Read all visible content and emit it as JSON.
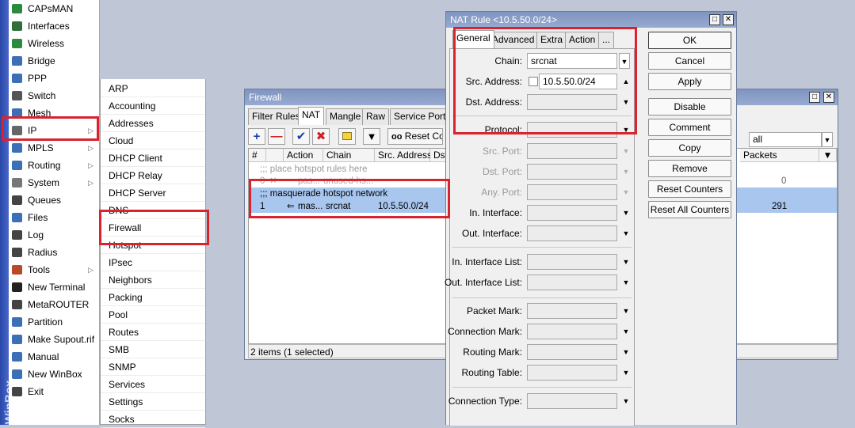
{
  "sidebar": {
    "brand": "WinBox",
    "items": [
      {
        "label": "CAPsMAN",
        "icon": "antenna-icon",
        "color": "#2b8a3e"
      },
      {
        "label": "Interfaces",
        "icon": "interfaces-icon",
        "color": "#2f6f3a"
      },
      {
        "label": "Wireless",
        "icon": "wireless-icon",
        "color": "#2b8a3e"
      },
      {
        "label": "Bridge",
        "icon": "bridge-icon",
        "color": "#3b6fb6"
      },
      {
        "label": "PPP",
        "icon": "ppp-icon",
        "color": "#3b6fb6"
      },
      {
        "label": "Switch",
        "icon": "switch-icon",
        "color": "#555555"
      },
      {
        "label": "Mesh",
        "icon": "mesh-icon",
        "color": "#3b6fb6"
      },
      {
        "label": "IP",
        "icon": "ip-icon",
        "color": "#666666",
        "arrow": true
      },
      {
        "label": "MPLS",
        "icon": "mpls-icon",
        "color": "#3b6fb6",
        "arrow": true
      },
      {
        "label": "Routing",
        "icon": "routing-icon",
        "color": "#3b6fb6",
        "arrow": true
      },
      {
        "label": "System",
        "icon": "gear-icon",
        "color": "#777777",
        "arrow": true
      },
      {
        "label": "Queues",
        "icon": "queues-icon",
        "color": "#444444"
      },
      {
        "label": "Files",
        "icon": "folder-icon",
        "color": "#3b6fb6"
      },
      {
        "label": "Log",
        "icon": "log-icon",
        "color": "#444444"
      },
      {
        "label": "Radius",
        "icon": "radius-icon",
        "color": "#444444"
      },
      {
        "label": "Tools",
        "icon": "tools-icon",
        "color": "#b84a2a",
        "arrow": true
      },
      {
        "label": "New Terminal",
        "icon": "terminal-icon",
        "color": "#222222"
      },
      {
        "label": "MetaROUTER",
        "icon": "metarouter-icon",
        "color": "#444444"
      },
      {
        "label": "Partition",
        "icon": "partition-icon",
        "color": "#3b6fb6"
      },
      {
        "label": "Make Supout.rif",
        "icon": "supout-icon",
        "color": "#3b6fb6"
      },
      {
        "label": "Manual",
        "icon": "manual-icon",
        "color": "#3b6fb6"
      },
      {
        "label": "New WinBox",
        "icon": "winbox-icon",
        "color": "#3b6fb6"
      },
      {
        "label": "Exit",
        "icon": "exit-icon",
        "color": "#444444"
      }
    ]
  },
  "ip_submenu": {
    "items": [
      "ARP",
      "Accounting",
      "Addresses",
      "Cloud",
      "DHCP Client",
      "DHCP Relay",
      "DHCP Server",
      "DNS",
      "Firewall",
      "Hotspot",
      "IPsec",
      "Neighbors",
      "Packing",
      "Pool",
      "Routes",
      "SMB",
      "SNMP",
      "Services",
      "Settings",
      "Socks"
    ]
  },
  "firewall": {
    "title": "Firewall",
    "tabs": [
      "Filter Rules",
      "NAT",
      "Mangle",
      "Raw",
      "Service Ports"
    ],
    "reset_label": "Reset Co",
    "search_value": "all",
    "columns": [
      "#",
      "Action",
      "Chain",
      "Src. Address",
      "Dst",
      "Packets"
    ],
    "comment_row": ";;; place hotspot rules here",
    "row0": {
      "num": "0",
      "action": "pas...",
      "extra": "unused-hs...",
      "packets": "0"
    },
    "comment2": ";;; masquerade hotspot network",
    "row1": {
      "num": "1",
      "action": "mas...",
      "chain": "srcnat",
      "src": "10.5.50.0/24",
      "packets": "291"
    },
    "status": "2 items (1 selected)"
  },
  "nat": {
    "title": "NAT Rule <10.5.50.0/24>",
    "tabs": [
      "General",
      "Advanced",
      "Extra",
      "Action",
      "..."
    ],
    "fields": {
      "chain_label": "Chain:",
      "chain_value": "srcnat",
      "src_label": "Src. Address:",
      "src_value": "10.5.50.0/24",
      "dst_label": "Dst. Address:",
      "protocol_label": "Protocol:",
      "srcport_label": "Src. Port:",
      "dstport_label": "Dst. Port:",
      "anyport_label": "Any. Port:",
      "inif_label": "In. Interface:",
      "outif_label": "Out. Interface:",
      "iniflist_label": "In. Interface List:",
      "outiflist_label": "Out. Interface List:",
      "pktmark_label": "Packet Mark:",
      "connmark_label": "Connection Mark:",
      "routemark_label": "Routing Mark:",
      "routetable_label": "Routing Table:",
      "conntype_label": "Connection Type:"
    },
    "buttons": {
      "ok": "OK",
      "cancel": "Cancel",
      "apply": "Apply",
      "disable": "Disable",
      "comment": "Comment",
      "copy": "Copy",
      "remove": "Remove",
      "reset_counters": "Reset Counters",
      "reset_all": "Reset All Counters"
    }
  },
  "colors": {
    "highlight": "#d9232e",
    "selection": "#a8c6ee",
    "titlebar": "#8aa0cc"
  }
}
